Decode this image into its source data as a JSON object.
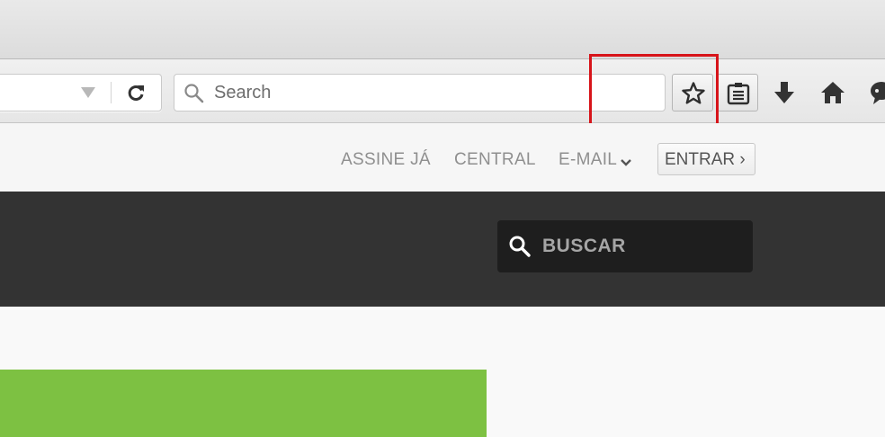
{
  "browser": {
    "search_placeholder": "Search",
    "icons": [
      "reload-icon",
      "search-icon",
      "star-icon",
      "reading-list-icon",
      "download-icon",
      "home-icon",
      "chat-icon"
    ],
    "highlight_color": "#d7141a"
  },
  "site": {
    "top_links": {
      "subscribe": "ASSINE JÁ",
      "central": "CENTRAL",
      "email": "E-MAIL",
      "login": "ENTRAR ›"
    },
    "search_placeholder": "BUSCAR",
    "colors": {
      "header_bg": "#333333",
      "search_bg": "#1e1e1e",
      "accent_green": "#7dc142"
    }
  }
}
